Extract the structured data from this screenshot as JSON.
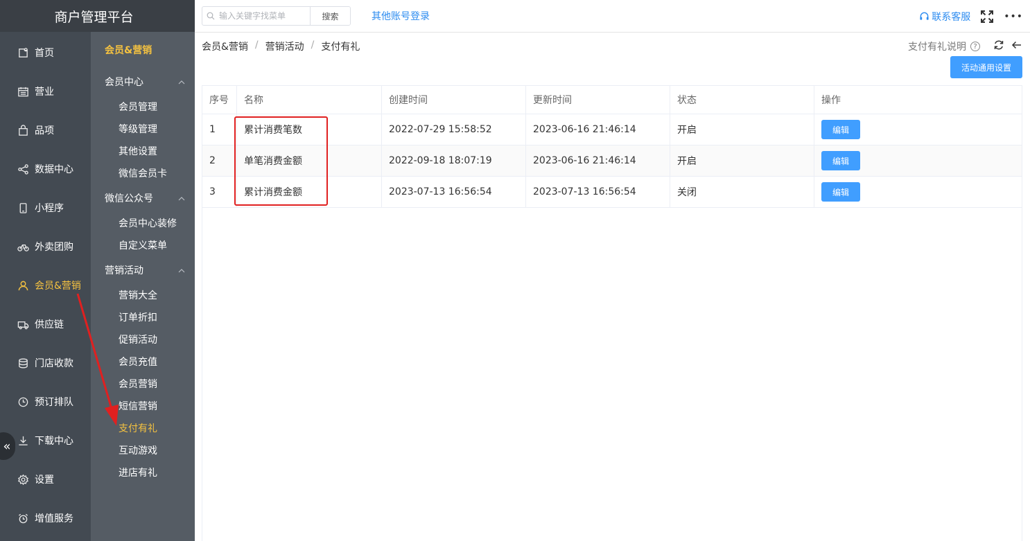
{
  "app": {
    "title": "商户管理平台"
  },
  "nav": {
    "items": [
      {
        "label": "首页",
        "icon": "home-icon"
      },
      {
        "label": "营业",
        "icon": "calendar-icon"
      },
      {
        "label": "品项",
        "icon": "bag-icon"
      },
      {
        "label": "数据中心",
        "icon": "share-icon"
      },
      {
        "label": "小程序",
        "icon": "phone-icon"
      },
      {
        "label": "外卖团购",
        "icon": "bike-icon"
      },
      {
        "label": "会员&营销",
        "icon": "user-icon"
      },
      {
        "label": "供应链",
        "icon": "truck-icon"
      },
      {
        "label": "门店收款",
        "icon": "database-icon"
      },
      {
        "label": "预订排队",
        "icon": "clock-icon"
      },
      {
        "label": "下载中心",
        "icon": "download-icon"
      },
      {
        "label": "设置",
        "icon": "gear-icon"
      },
      {
        "label": "增值服务",
        "icon": "alarm-icon"
      }
    ],
    "active_index": 6,
    "collapse_glyph": "«"
  },
  "subnav": {
    "title": "会员&营销",
    "groups": [
      {
        "label": "会员中心",
        "items": [
          "会员管理",
          "等级管理",
          "其他设置",
          "微信会员卡"
        ]
      },
      {
        "label": "微信公众号",
        "items": [
          "会员中心装修",
          "自定义菜单"
        ]
      },
      {
        "label": "营销活动",
        "items": [
          "营销大全",
          "订单折扣",
          "促销活动",
          "会员充值",
          "会员营销",
          "短信营销",
          "支付有礼",
          "互动游戏",
          "进店有礼"
        ]
      }
    ],
    "active_item": "支付有礼"
  },
  "topbar": {
    "search_placeholder": "输入关键字找菜单",
    "search_button": "搜索",
    "other_login": "其他账号登录",
    "customer_service": "联系客服",
    "more": "•••"
  },
  "breadcrumb": [
    "会员&营销",
    "营销活动",
    "支付有礼"
  ],
  "page": {
    "help_label": "支付有礼说明",
    "help_glyph": "?",
    "settings_button": "活动通用设置"
  },
  "table": {
    "headers": [
      "序号",
      "名称",
      "创建时间",
      "更新时间",
      "状态",
      "操作"
    ],
    "rows": [
      {
        "no": "1",
        "name": "累计消费笔数",
        "created": "2022-07-29 15:58:52",
        "updated": "2023-06-16 21:46:14",
        "status": "开启",
        "action": "编辑"
      },
      {
        "no": "2",
        "name": "单笔消费金额",
        "created": "2022-09-18 18:07:19",
        "updated": "2023-06-16 21:46:14",
        "status": "开启",
        "action": "编辑"
      },
      {
        "no": "3",
        "name": "累计消费金额",
        "created": "2023-07-13 16:56:54",
        "updated": "2023-07-13 16:56:54",
        "status": "关闭",
        "action": "编辑"
      }
    ]
  },
  "colors": {
    "sidebar": "#434a52",
    "subnav": "#555c64",
    "accent": "#f5c240",
    "primary": "#409eff",
    "link": "#2d8cf0",
    "annotation": "#e02020"
  }
}
